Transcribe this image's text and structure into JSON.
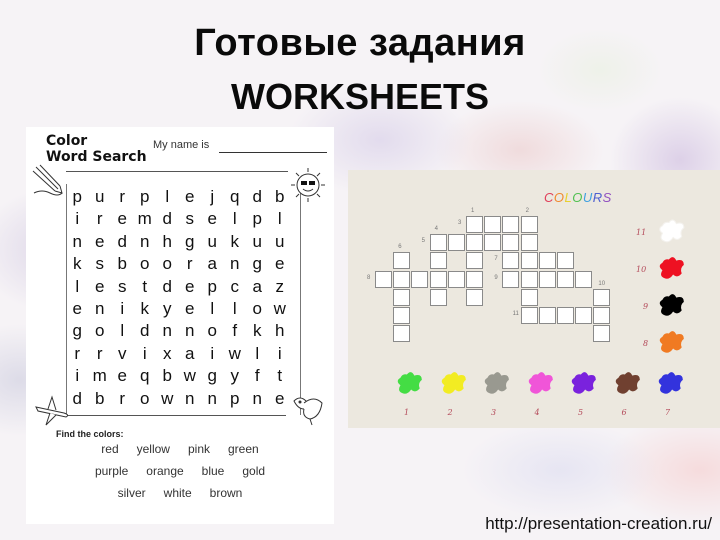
{
  "slide": {
    "title_line1": "Готовые задания",
    "title_line2": "WORKSHEETS",
    "url": "http://presentation-creation.ru/"
  },
  "word_search": {
    "title_line1": "Color",
    "title_line2": "Word Search",
    "name_prompt": "My name is",
    "grid": [
      [
        "p",
        "u",
        "r",
        "p",
        "l",
        "e",
        "j",
        "q",
        "d",
        "b"
      ],
      [
        "i",
        "r",
        "e",
        "m",
        "d",
        "s",
        "e",
        "l",
        "p",
        "l"
      ],
      [
        "n",
        "e",
        "d",
        "n",
        "h",
        "g",
        "u",
        "k",
        "u",
        "u"
      ],
      [
        "k",
        "s",
        "b",
        "o",
        "o",
        "r",
        "a",
        "n",
        "g",
        "e"
      ],
      [
        "l",
        "e",
        "s",
        "t",
        "d",
        "e",
        "p",
        "c",
        "a",
        "z"
      ],
      [
        "e",
        "n",
        "i",
        "k",
        "y",
        "e",
        "l",
        "l",
        "o",
        "w"
      ],
      [
        "g",
        "o",
        "l",
        "d",
        "n",
        "n",
        "o",
        "f",
        "k",
        "h"
      ],
      [
        "r",
        "r",
        "v",
        "i",
        "x",
        "a",
        "i",
        "w",
        "l",
        "i"
      ],
      [
        "i",
        "m",
        "e",
        "q",
        "b",
        "w",
        "g",
        "y",
        "f",
        "t"
      ],
      [
        "d",
        "b",
        "r",
        "o",
        "w",
        "n",
        "n",
        "p",
        "n",
        "e"
      ]
    ],
    "find_label": "Find the colors:",
    "word_rows": [
      [
        "red",
        "yellow",
        "pink",
        "green"
      ],
      [
        "purple",
        "orange",
        "blue",
        "gold"
      ],
      [
        "silver",
        "white",
        "brown"
      ]
    ],
    "icons": [
      "pencil-icon",
      "sun-with-sunglasses-icon",
      "airplane-icon",
      "bird-icon"
    ]
  },
  "crossword": {
    "title": "COLOURS",
    "title_colors": [
      "#e0405a",
      "#f08a30",
      "#e8d030",
      "#50c050",
      "#40a0e0",
      "#5060d0",
      "#9050c0"
    ],
    "clue_numbers": [
      "1",
      "2",
      "3",
      "4",
      "5",
      "6",
      "7",
      "8",
      "9",
      "10",
      "11"
    ],
    "bottom_swatches": [
      {
        "number": "1",
        "color": "#44dd44"
      },
      {
        "number": "2",
        "color": "#f2ec22"
      },
      {
        "number": "3",
        "color": "#999990"
      },
      {
        "number": "4",
        "color": "#f055d8"
      },
      {
        "number": "5",
        "color": "#7a22dd"
      },
      {
        "number": "6",
        "color": "#704030"
      },
      {
        "number": "7",
        "color": "#3333dd"
      }
    ],
    "side_swatches": [
      {
        "number": "11",
        "color": "#ffffff"
      },
      {
        "number": "10",
        "color": "#ee1122"
      },
      {
        "number": "9",
        "color": "#000000"
      },
      {
        "number": "8",
        "color": "#f07a22"
      }
    ]
  }
}
